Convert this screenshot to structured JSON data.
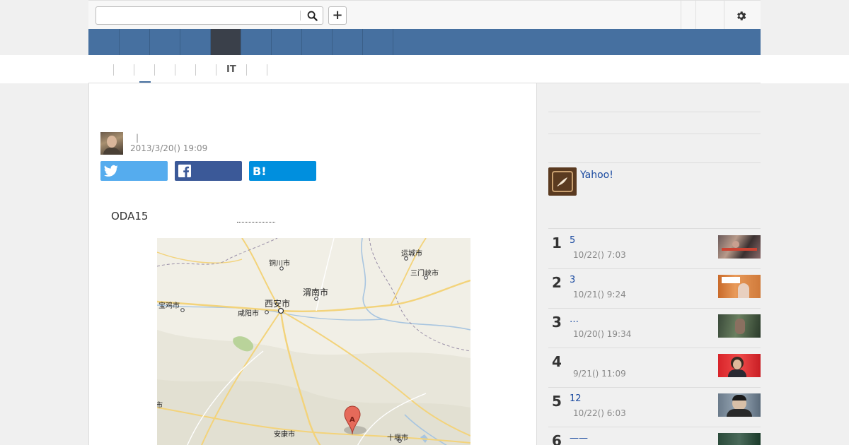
{
  "header": {
    "search_placeholder": "",
    "search_icon": "search-icon",
    "plus_label": "+",
    "settings_icon": "gear-icon"
  },
  "nav": {
    "items": [
      "",
      "",
      "",
      "",
      "",
      "",
      "",
      "",
      "",
      ""
    ],
    "active_index": 5
  },
  "subnav": {
    "items": [
      "",
      "",
      "",
      "",
      "",
      "IT",
      "",
      ""
    ],
    "active_index": 1
  },
  "article": {
    "title": "",
    "author_separator": "|",
    "date": "2013/3/20() 19:09",
    "body_intro": "ODA15",
    "map": {
      "labels": [
        "运城市",
        "铜川市",
        "三门峡市",
        "渭南市",
        "宝鸡市",
        "西安市",
        "咸阳市",
        "安康市",
        "十堰市",
        "汉中市"
      ],
      "marker": "A"
    }
  },
  "share": {
    "twitter_icon": "twitter-icon",
    "facebook_icon": "facebook-icon",
    "hatena_label": "B!"
  },
  "sidebar": {
    "yahoo_label": "Yahoo!",
    "ranking": [
      {
        "rank": "1",
        "title": "5",
        "date": "10/22() 7:03"
      },
      {
        "rank": "2",
        "title": "3",
        "date": "10/21() 9:24"
      },
      {
        "rank": "3",
        "title": "…",
        "date": "10/20() 19:34"
      },
      {
        "rank": "4",
        "title": "",
        "date": "9/21() 11:09"
      },
      {
        "rank": "5",
        "title": "12",
        "date": "10/22() 6:03"
      },
      {
        "rank": "6",
        "title": "——",
        "date": ""
      }
    ]
  },
  "colors": {
    "nav_blue": "#4670a0",
    "nav_active": "#3a404a",
    "twitter": "#55acee",
    "facebook": "#3b5998",
    "hatena": "#008fde",
    "link": "#1a4aa0"
  }
}
